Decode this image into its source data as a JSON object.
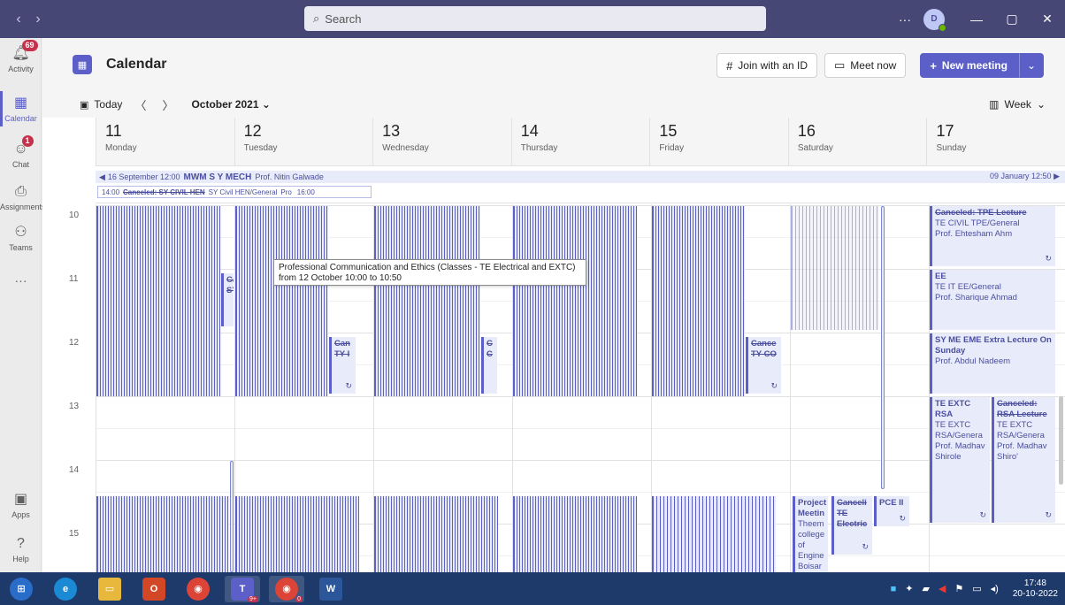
{
  "titlebar": {
    "search_placeholder": "Search",
    "more": "···",
    "avatar_initials": "D"
  },
  "rail": {
    "items": [
      {
        "label": "Activity",
        "badge": "69"
      },
      {
        "label": "Calendar"
      },
      {
        "label": "Chat",
        "badge": "1"
      },
      {
        "label": "Assignments"
      },
      {
        "label": "Teams"
      },
      {
        "label": "···"
      },
      {
        "label": "Apps"
      },
      {
        "label": "Help"
      }
    ]
  },
  "header": {
    "title": "Calendar",
    "join_id": "Join with an ID",
    "meet_now": "Meet now",
    "new_meeting": "New meeting"
  },
  "toolbar": {
    "today": "Today",
    "month": "October 2021",
    "view": "Week"
  },
  "days": [
    {
      "num": "11",
      "name": "Monday"
    },
    {
      "num": "12",
      "name": "Tuesday"
    },
    {
      "num": "13",
      "name": "Wednesday"
    },
    {
      "num": "14",
      "name": "Thursday"
    },
    {
      "num": "15",
      "name": "Friday"
    },
    {
      "num": "16",
      "name": "Saturday"
    },
    {
      "num": "17",
      "name": "Sunday"
    }
  ],
  "allday": {
    "bar1_start": "16 September 12:00",
    "bar1_title": "MWM S Y MECH",
    "bar1_organizer": "Prof. Nitin Galwade",
    "bar1_end": "09 January 12:50",
    "bar2_time": "14:00",
    "bar2_cancel": "Canceled: SY CIVIL HEN",
    "bar2_channel": "SY Civil HEN/General",
    "bar2_org": "Pro",
    "bar2_end": "16:00"
  },
  "hours": [
    "10",
    "11",
    "12",
    "13",
    "14",
    "15"
  ],
  "tooltip": {
    "line1": "Professional Communication and Ethics (Classes - TE Electrical and EXTC)",
    "line2": "from 12 October 10:00 to 10:50"
  },
  "events": {
    "sun_tpe_title": "Canceled: TPE Lecture",
    "sun_tpe_channel": "TE CIVIL TPE/General",
    "sun_tpe_org": "Prof. Ehtesham Ahm",
    "sun_ee_title": "EE",
    "sun_ee_channel": "TE IT EE/General",
    "sun_ee_org": "Prof. Sharique Ahmad",
    "sun_eme_title": "SY ME EME Extra Lecture On Sunday",
    "sun_eme_org": "Prof. Abdul Nadeem",
    "sun_rsa1_title": "TE EXTC RSA",
    "sun_rsa1_channel": "TE EXTC RSA/Genera",
    "sun_rsa1_org": "Prof. Madhav Shirole",
    "sun_rsa2_title": "Canceled: RSA Lecture",
    "sun_rsa2_channel": "TE EXTC RSA/Genera",
    "sun_rsa2_org": "Prof. Madhav Shiro'",
    "sat_proj_title": "Project Meetin",
    "sat_proj_text": "Theem college of Engine Boisar Prof",
    "sat_cancel_title": "Canceli TE",
    "sat_cancel_text": "Electric",
    "sat_pce": "PCE II",
    "mon_car": "Car",
    "mon_sy": "SY",
    "tue_can": "Can",
    "tue_ty": "TY I",
    "wed_c": "C",
    "wed_c2": "C",
    "fri_cance": "Cance",
    "fri_ty": "TY CO"
  },
  "taskbar": {
    "teams_badge": "9+",
    "chrome_badge": "0",
    "time": "17:48",
    "date": "20-10-2022"
  }
}
